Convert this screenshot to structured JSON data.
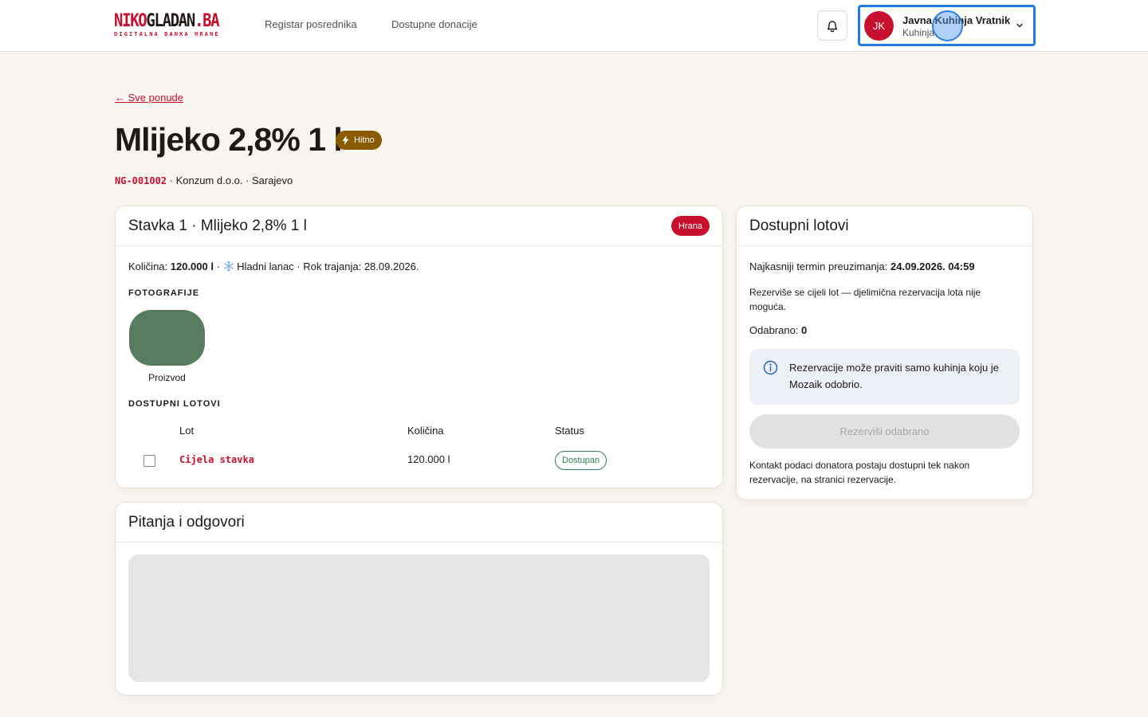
{
  "header": {
    "logo": {
      "part1": "NIKO",
      "part2": "GLADAN",
      "part3": ".BA",
      "tagline": "DIGITALNA BANKA HRANE"
    },
    "nav": [
      {
        "label": "Registar posrednika"
      },
      {
        "label": "Dostupne donacije"
      }
    ],
    "user": {
      "initials": "JK",
      "name": "Javna Kuhinja Vratnik",
      "role": "Kuhinja"
    }
  },
  "page": {
    "back_label": "← Sve ponude",
    "title": "Mlijeko 2,8% 1 l",
    "urgent_label": "Hitno",
    "code": "NG-001002",
    "meta_rest": " · Konzum d.o.o. · Sarajevo"
  },
  "item_card": {
    "title": "Stavka 1 · Mlijeko 2,8% 1 l",
    "category": "Hrana",
    "qty_label": "Količina: ",
    "qty_value": "120.000 l",
    "qty_sep": " · ",
    "cold_chain": " Hladni lanac · Rok trajanja: 28.09.2026.",
    "photos_label": "FOTOGRAFIJE",
    "photo_caption": "Proizvod",
    "lots_label": "DOSTUPNI LOTOVI",
    "columns": [
      "Lot",
      "Količina",
      "Status"
    ],
    "rows": [
      {
        "lot": "Cijela stavka",
        "qty": "120.000 l",
        "status": "Dostupan"
      }
    ]
  },
  "qa_card": {
    "title": "Pitanja i odgovori"
  },
  "lots_card": {
    "title": "Dostupni lotovi",
    "latest_label": "Najkasniji termin preuzimanja: ",
    "latest_value": "24.09.2026. 04:59",
    "reserve_note": "Rezerviše se cijeli lot — djelimična rezervacija lota nije moguća.",
    "selected_label": "Odabrano: ",
    "selected_value": "0",
    "info": "Rezervacije može praviti samo kuhinja koju je Mozaik odobrio.",
    "reserve_button": "Rezerviši odabrano",
    "contact_note": "Kontakt podaci donatora postaju dostupni tek nakon rezervacije, na stranici rezervacije."
  },
  "colors": {
    "brand": "#c8102e",
    "urgent": "#8a5a00",
    "available": "#2e7d4f",
    "focus": "#1d7be6"
  },
  "icons": [
    "bell-icon",
    "chevron-down-icon",
    "lightning-icon",
    "snowflake-icon",
    "info-icon"
  ]
}
